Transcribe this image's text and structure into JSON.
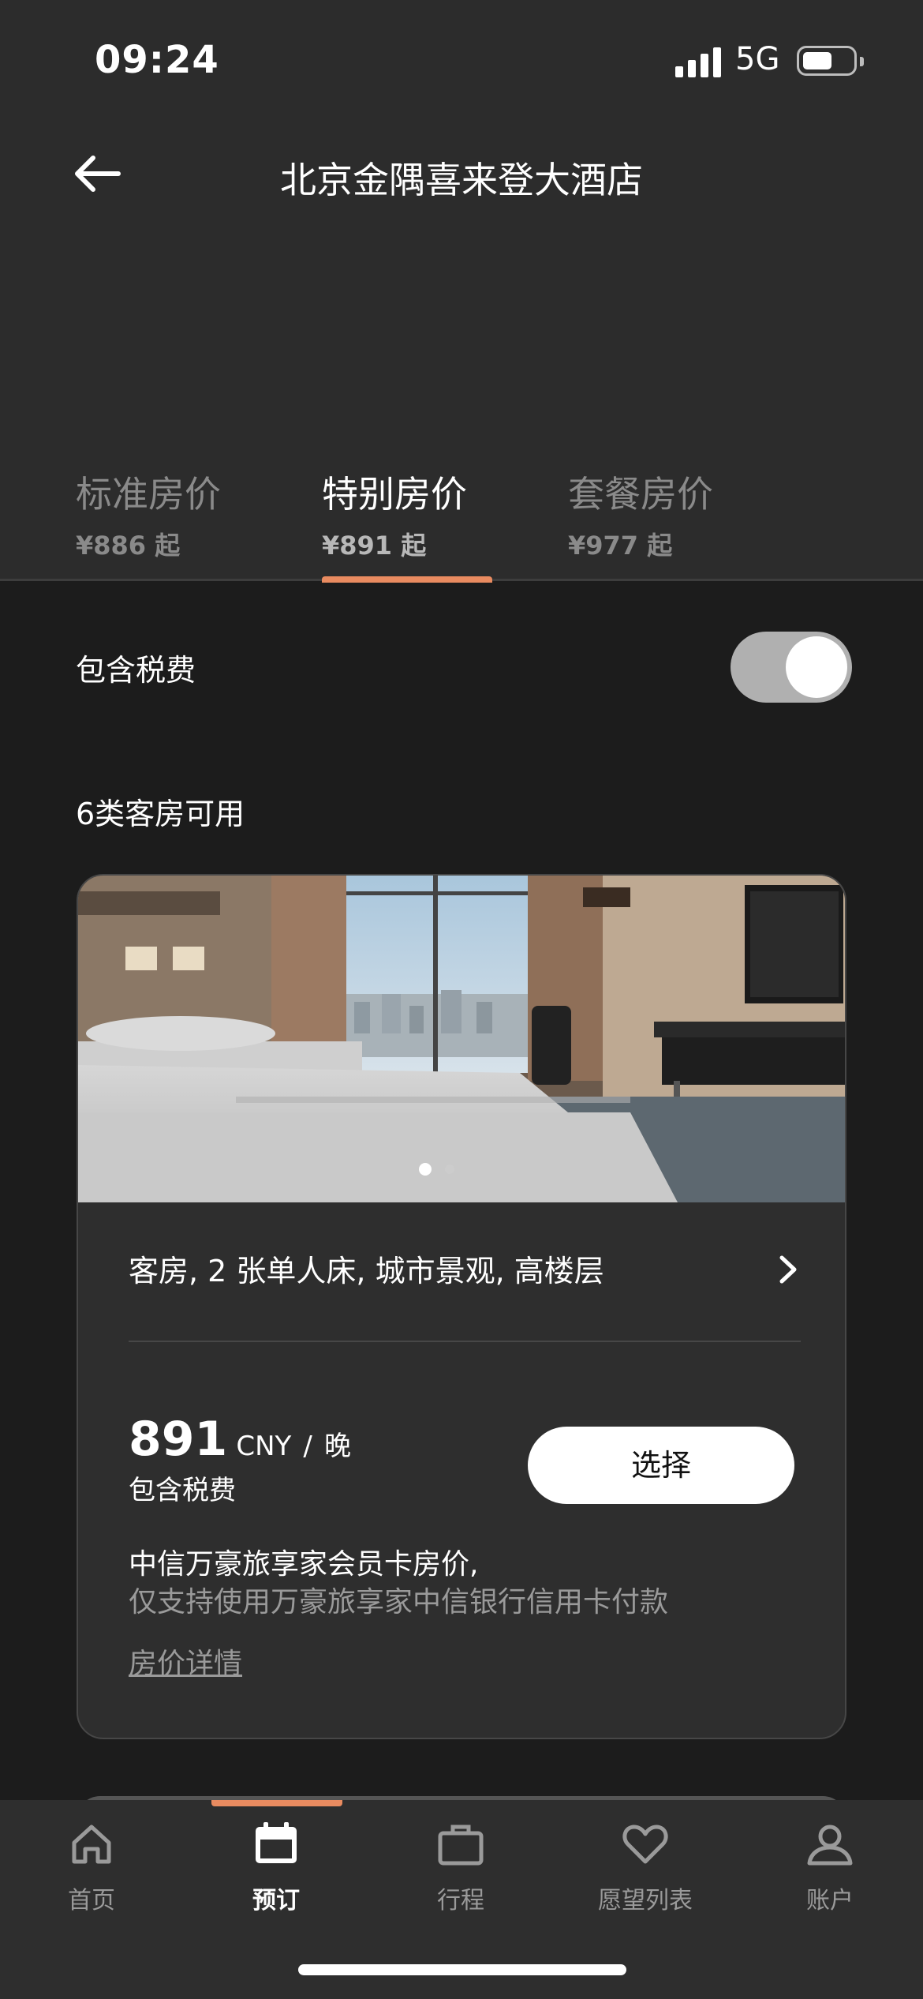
{
  "status_bar": {
    "time": "09:24",
    "network": "5G",
    "icons": [
      "signal-icon",
      "battery-icon"
    ]
  },
  "header": {
    "title": "北京金隅喜来登大酒店",
    "back_icon": "back-arrow-icon"
  },
  "rate_tabs": [
    {
      "name": "标准房价",
      "price": "¥886 起"
    },
    {
      "name": "特别房价",
      "price": "¥891 起",
      "active": true
    },
    {
      "name": "套餐房价",
      "price": "¥977 起"
    }
  ],
  "tax_toggle": {
    "label": "包含税费",
    "on": true
  },
  "rooms_count": "6类客房可用",
  "room_card": {
    "carousel": {
      "current": 1,
      "total": 2
    },
    "name": "客房, 2 张单人床, 城市景观, 高楼层",
    "price": {
      "amount": "891",
      "currency": "CNY",
      "separator": "/",
      "unit": "晚",
      "tax_note": "包含税费"
    },
    "select_label": "选择",
    "member_rate_title": "中信万豪旅享家会员卡房价,",
    "member_rate_note": "仅支持使用万豪旅享家中信银行信用卡付款",
    "rate_details_link": "房价详情"
  },
  "tab_bar": {
    "items": [
      {
        "label": "首页",
        "icon": "home-icon"
      },
      {
        "label": "预订",
        "icon": "calendar-icon",
        "active": true
      },
      {
        "label": "行程",
        "icon": "briefcase-icon"
      },
      {
        "label": "愿望列表",
        "icon": "heart-icon"
      },
      {
        "label": "账户",
        "icon": "user-icon"
      }
    ]
  },
  "colors": {
    "accent": "#e98b60",
    "background": "#1c1c1c",
    "header_bg": "#2c2c2c",
    "card_bg": "#2e2e2e"
  }
}
